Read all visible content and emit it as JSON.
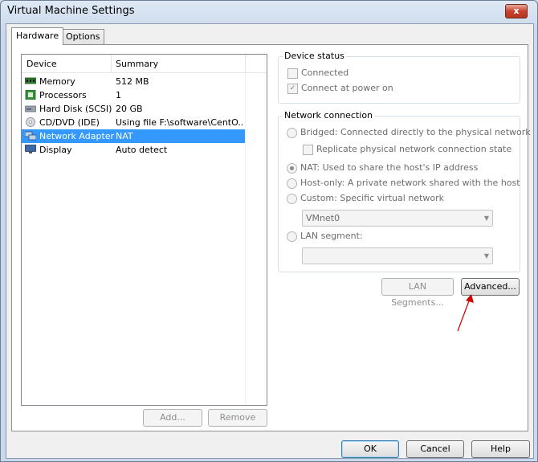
{
  "window": {
    "title": "Virtual Machine Settings",
    "close_label": "x"
  },
  "tabs": [
    {
      "label": "Hardware",
      "active": true
    },
    {
      "label": "Options",
      "active": false
    }
  ],
  "device_list": {
    "columns": [
      "Device",
      "Summary"
    ],
    "rows": [
      {
        "device": "Memory",
        "summary": "512 MB",
        "icon": "memory-icon"
      },
      {
        "device": "Processors",
        "summary": "1",
        "icon": "processor-icon"
      },
      {
        "device": "Hard Disk (SCSI)",
        "summary": "20 GB",
        "icon": "hard-disk-icon"
      },
      {
        "device": "CD/DVD (IDE)",
        "summary": "Using file F:\\software\\CentO...",
        "icon": "cd-dvd-icon"
      },
      {
        "device": "Network Adapter",
        "summary": "NAT",
        "icon": "network-adapter-icon",
        "selected": true
      },
      {
        "device": "Display",
        "summary": "Auto detect",
        "icon": "display-icon"
      }
    ]
  },
  "device_buttons": {
    "add": "Add...",
    "remove": "Remove"
  },
  "device_status": {
    "title": "Device status",
    "connected": {
      "label": "Connected",
      "checked": false
    },
    "connect_at_power_on": {
      "label": "Connect at power on",
      "checked": true
    }
  },
  "network_connection": {
    "title": "Network connection",
    "bridged": "Bridged: Connected directly to the physical network",
    "replicate": "Replicate physical network connection state",
    "nat": "NAT: Used to share the host's IP address",
    "host_only": "Host-only: A private network shared with the host",
    "custom": "Custom: Specific virtual network",
    "custom_value": "VMnet0",
    "lan_segment": "LAN segment:",
    "lan_segment_value": "",
    "selected": "nat"
  },
  "lan_buttons": {
    "lan_segments": "LAN Segments...",
    "advanced": "Advanced..."
  },
  "dialog_buttons": {
    "ok": "OK",
    "cancel": "Cancel",
    "help": "Help"
  },
  "annotation": {
    "color": "#d40000"
  }
}
